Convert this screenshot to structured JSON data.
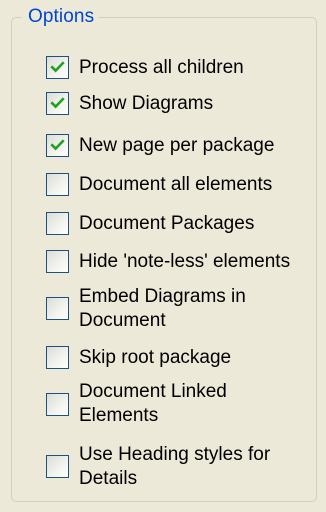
{
  "group": {
    "title": "Options"
  },
  "colors": {
    "title": "#0046d5",
    "checkmark": "#21a121",
    "checkbox_border": "#1c5180",
    "panel_background": "#ece9d8"
  },
  "options": [
    {
      "label": "Process all children",
      "checked": true
    },
    {
      "label": "Show Diagrams",
      "checked": true
    },
    {
      "label": "New page per package",
      "checked": true
    },
    {
      "label": "Document all elements",
      "checked": false
    },
    {
      "label": "Document Packages",
      "checked": false
    },
    {
      "label": "Hide 'note-less' elements",
      "checked": false
    },
    {
      "label_lines": [
        "Embed Diagrams in",
        "Document"
      ],
      "checked": false
    },
    {
      "label": "Skip root package",
      "checked": false
    },
    {
      "label_lines": [
        "Document Linked",
        "Elements"
      ],
      "checked": false
    },
    {
      "label_lines": [
        "Use Heading styles for",
        "Details"
      ],
      "checked": false
    }
  ]
}
